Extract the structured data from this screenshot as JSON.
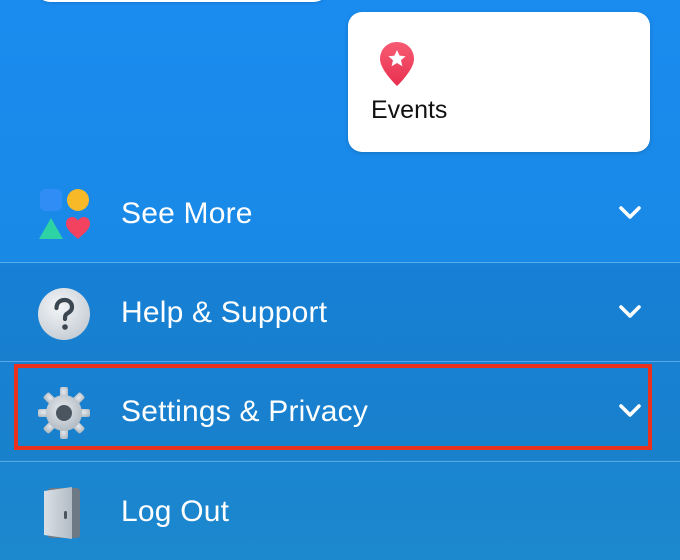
{
  "shortcuts": {
    "events": {
      "label": "Events",
      "icon": "events-star-pin-icon",
      "icon_color": "#f0445f"
    }
  },
  "menu": {
    "items": [
      {
        "label": "See More",
        "icon": "see-more-shapes-icon",
        "chevron": "chevron-down-icon"
      },
      {
        "label": "Help & Support",
        "icon": "question-mark-icon",
        "chevron": "chevron-down-icon"
      },
      {
        "label": "Settings & Privacy",
        "icon": "gear-icon",
        "chevron": "chevron-down-icon"
      },
      {
        "label": "Log Out",
        "icon": "door-icon"
      }
    ]
  },
  "colors": {
    "background": "#1a8cf0",
    "highlight": "#e8321e",
    "card": "#ffffff"
  }
}
